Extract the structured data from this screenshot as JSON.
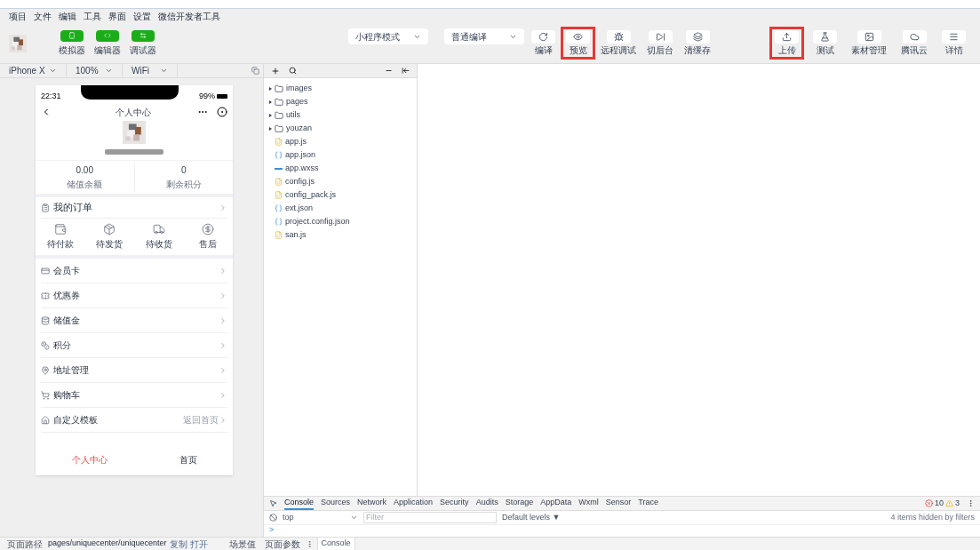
{
  "menu": [
    "项目",
    "文件",
    "编辑",
    "工具",
    "界面",
    "设置",
    "微信开发者工具"
  ],
  "toolbar": {
    "view_buttons": [
      {
        "label": "模拟器"
      },
      {
        "label": "编辑器"
      },
      {
        "label": "调试器"
      }
    ],
    "mode_select": "小程序模式",
    "compile_select": "普通编译",
    "actions": [
      {
        "label": "编译",
        "highlighted": false
      },
      {
        "label": "预览",
        "highlighted": true
      },
      {
        "label": "远程调试",
        "highlighted": false
      },
      {
        "label": "切后台",
        "highlighted": false
      },
      {
        "label": "清缓存",
        "highlighted": false
      }
    ],
    "right_actions": [
      {
        "label": "上传",
        "highlighted": true
      },
      {
        "label": "测试",
        "highlighted": false
      },
      {
        "label": "素材管理",
        "highlighted": false
      },
      {
        "label": "腾讯云",
        "highlighted": false
      },
      {
        "label": "详情",
        "highlighted": false
      }
    ]
  },
  "device_bar": {
    "device": "iPhone X",
    "zoom": "100%",
    "network": "WiFi"
  },
  "phone": {
    "time": "22:31",
    "battery": "99%",
    "title": "个人中心",
    "stats": [
      {
        "value": "0.00",
        "label": "储值余额"
      },
      {
        "value": "0",
        "label": "剩余积分"
      }
    ],
    "orders": {
      "title": "我的订单",
      "items": [
        "待付款",
        "待发货",
        "待收货",
        "售后"
      ]
    },
    "menu_items": [
      {
        "label": "会员卡"
      },
      {
        "label": "优惠券"
      },
      {
        "label": "储值金"
      },
      {
        "label": "积分"
      },
      {
        "label": "地址管理"
      },
      {
        "label": "购物车"
      },
      {
        "label": "自定义模板",
        "note": "返回首页"
      }
    ],
    "tabbar": [
      {
        "label": "个人中心",
        "selected": true
      },
      {
        "label": "首页",
        "selected": false
      }
    ]
  },
  "file_tree": [
    {
      "name": "images",
      "kind": "folder"
    },
    {
      "name": "pages",
      "kind": "folder"
    },
    {
      "name": "utils",
      "kind": "folder"
    },
    {
      "name": "youzan",
      "kind": "folder"
    },
    {
      "name": "app.js",
      "kind": "js"
    },
    {
      "name": "app.json",
      "kind": "json"
    },
    {
      "name": "app.wxss",
      "kind": "wxss"
    },
    {
      "name": "config.js",
      "kind": "js"
    },
    {
      "name": "config_pack.js",
      "kind": "js"
    },
    {
      "name": "ext.json",
      "kind": "json"
    },
    {
      "name": "project.config.json",
      "kind": "json"
    },
    {
      "name": "san.js",
      "kind": "js"
    }
  ],
  "console": {
    "tabs": [
      {
        "label": "Console",
        "selected": true
      },
      {
        "label": "Sources",
        "selected": false
      },
      {
        "label": "Network",
        "selected": false
      },
      {
        "label": "Application",
        "selected": false
      },
      {
        "label": "Security",
        "selected": false
      },
      {
        "label": "Audits",
        "selected": false
      },
      {
        "label": "Storage",
        "selected": false
      },
      {
        "label": "AppData",
        "selected": false
      },
      {
        "label": "Wxml",
        "selected": false
      },
      {
        "label": "Sensor",
        "selected": false
      },
      {
        "label": "Trace",
        "selected": false
      }
    ],
    "errors": "10",
    "warnings": "3",
    "context": "top",
    "filter_placeholder": "Filter",
    "levels": "Default levels ▼",
    "hidden_note": "4 items hidden by filters",
    "prompt": ">",
    "drawer_tab": "Console"
  },
  "status_bar": {
    "path_label": "页面路径",
    "path": "pages/uniquecenter/uniquecenter",
    "links": [
      "复制",
      "打开"
    ],
    "scene": "场景值",
    "params": "页面参数"
  }
}
